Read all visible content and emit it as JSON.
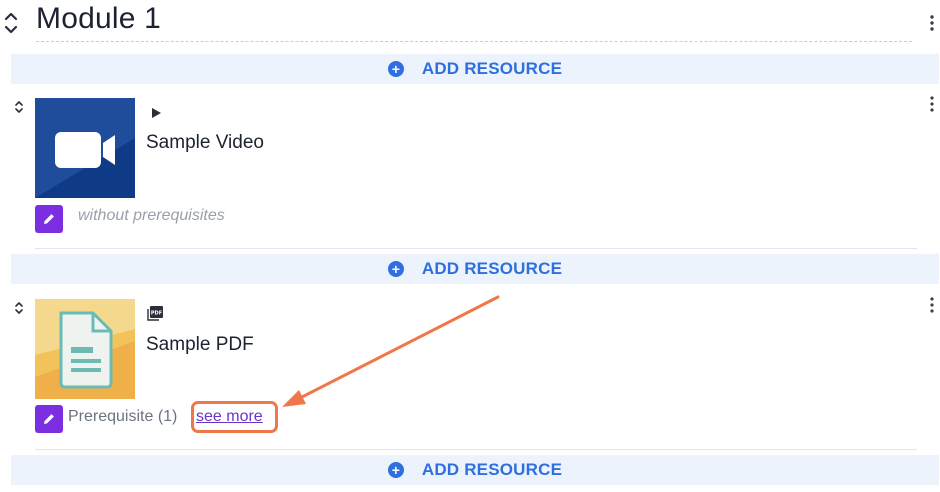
{
  "module": {
    "title": "Module 1"
  },
  "add_resource_label": "ADD RESOURCE",
  "resources": [
    {
      "title": "Sample Video",
      "type_icon": "play-icon",
      "thumbnail_icon": "video-camera-icon",
      "prerequisite_text": "without prerequisites"
    },
    {
      "title": "Sample PDF",
      "type_icon": "pdf-icon",
      "thumbnail_icon": "document-icon",
      "prerequisite_text": "Prerequisite (1)",
      "see_more_label": "see more"
    }
  ],
  "colors": {
    "accent_blue": "#2f6fde",
    "add_bar_bg": "#edf3fd",
    "edit_purple": "#7b2fe0",
    "annotation_orange": "#f0774a",
    "video_thumb": "#1f4d9c",
    "pdf_thumb": "#f2c35a"
  }
}
